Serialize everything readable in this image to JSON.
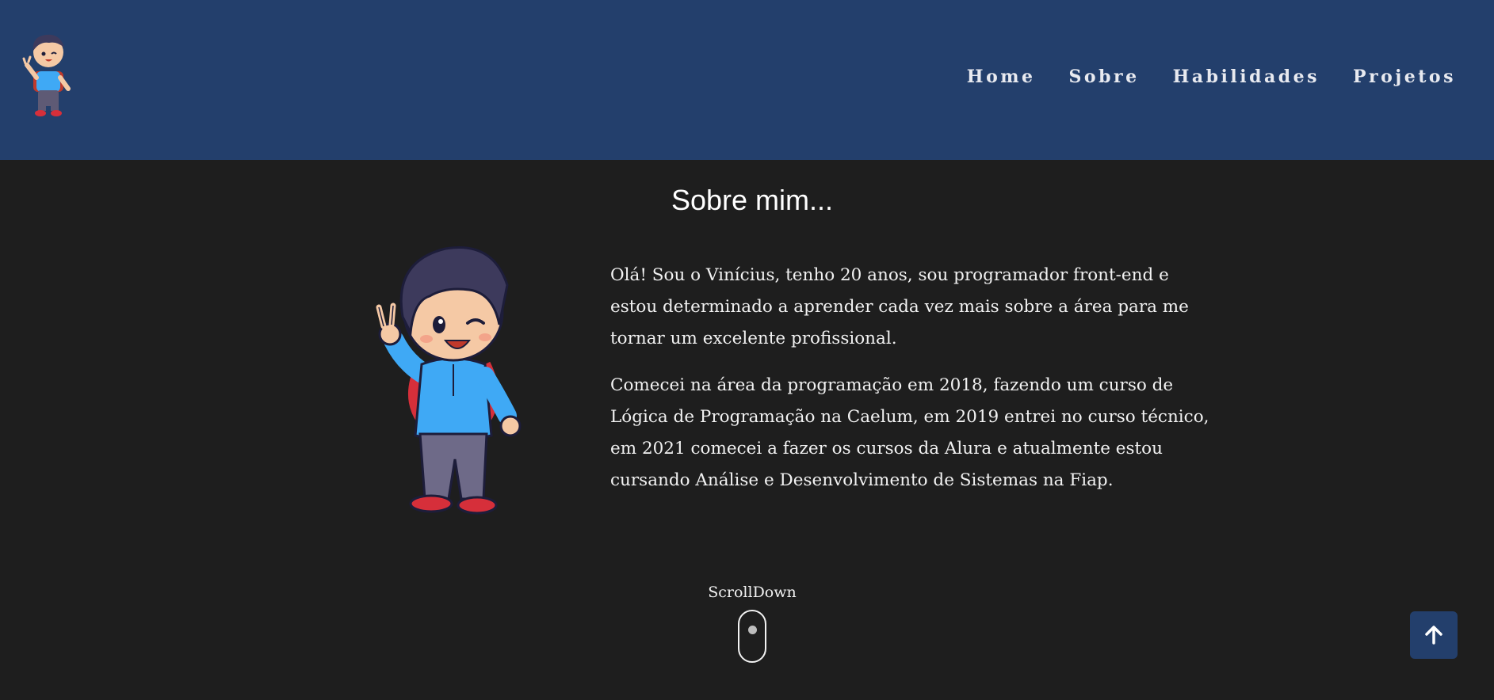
{
  "nav": {
    "items": [
      "Home",
      "Sobre",
      "Habilidades",
      "Projetos"
    ]
  },
  "about": {
    "title": "Sobre mim...",
    "paragraphs": [
      "Olá! Sou o Vinícius, tenho 20 anos, sou programador front-end e estou determinado a aprender cada vez mais sobre a área para me tornar um excelente profissional.",
      "Comecei na área da programação em 2018, fazendo um curso de Lógica de Programação na Caelum, em 2019 entrei no curso técnico, em 2021 comecei a fazer os cursos da Alura e atualmente estou cursando Análise e Desenvolvimento de Sistemas na Fiap."
    ]
  },
  "scroll": {
    "label": "ScrollDown"
  },
  "icons": {
    "logo": "cartoon-boy-logo",
    "mascot": "cartoon-boy-peace-sign",
    "back_to_top": "arrow-up-icon",
    "scroll": "mouse-scroll-icon"
  },
  "colors": {
    "header_bg": "#233f6c",
    "page_bg": "#1e1e1e",
    "text": "#f2f2f2"
  }
}
